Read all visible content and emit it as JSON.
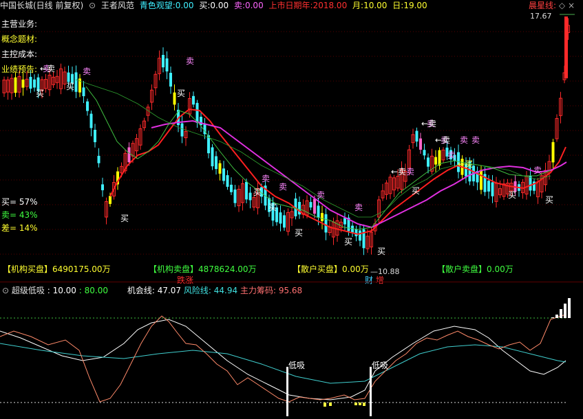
{
  "header": {
    "title": "中国长城(日线 前复权)",
    "indicator": "王者风范",
    "qingse_label": "青色观望:",
    "qingse_value": "0.00",
    "buy_label": "买:",
    "buy_value": "0.00",
    "sell_label": "卖:",
    "sell_value": "0.00",
    "list_year_label": "上市日期年:",
    "list_year_value": "2018.00",
    "month_label": "月:",
    "month_value": "10.00",
    "day_label": "日:",
    "day_value": "19.00",
    "right_label": "晨星线:",
    "price_top": "17.67"
  },
  "info_labels": [
    "主营业务:",
    "概念题材:",
    "主控成本:",
    "业绩预告:"
  ],
  "stats": {
    "buy": "买= 57%",
    "sell": "卖= 43%",
    "diff": "差= 14%"
  },
  "flow": {
    "inst_buy_label": "【机构买盘】",
    "inst_buy_value": "6490175.00万",
    "inst_sell_label": "【机构卖盘】",
    "inst_sell_value": "4878624.00万",
    "retail_buy_label": "【散户买盘】",
    "retail_buy_value": "0.00万",
    "retail_sell_label": "【散户卖盘】",
    "retail_sell_value": "0.00万"
  },
  "markers": {
    "low_price": "10.88",
    "tag_fall": "跌",
    "tag_rise": "涨",
    "tag_cai": "财",
    "tag_zeng": "增",
    "buy": "买",
    "sell": "卖",
    "buy_arrow": "←买",
    "sell_arrow": "←卖"
  },
  "sub": {
    "name": "超级低吸",
    "param1": ": 10.00",
    "param2": ": 80.00",
    "chance_label": "机会线:",
    "chance_value": "47.07",
    "risk_label": "风险线:",
    "risk_value": "44.94",
    "main_label": "主力筹码:",
    "main_value": "95.68",
    "low_absorb": "低吸"
  },
  "colors": {
    "up": "#ff2a2a",
    "down": "#3ff0ff",
    "yellow": "#ffff00",
    "pink": "#ff66cc",
    "ma_red": "#ff2020",
    "ma_magenta": "#e030e0",
    "ma_green": "#40c040",
    "kline_yellow": "#ffff40",
    "white": "#ffffff"
  }
}
